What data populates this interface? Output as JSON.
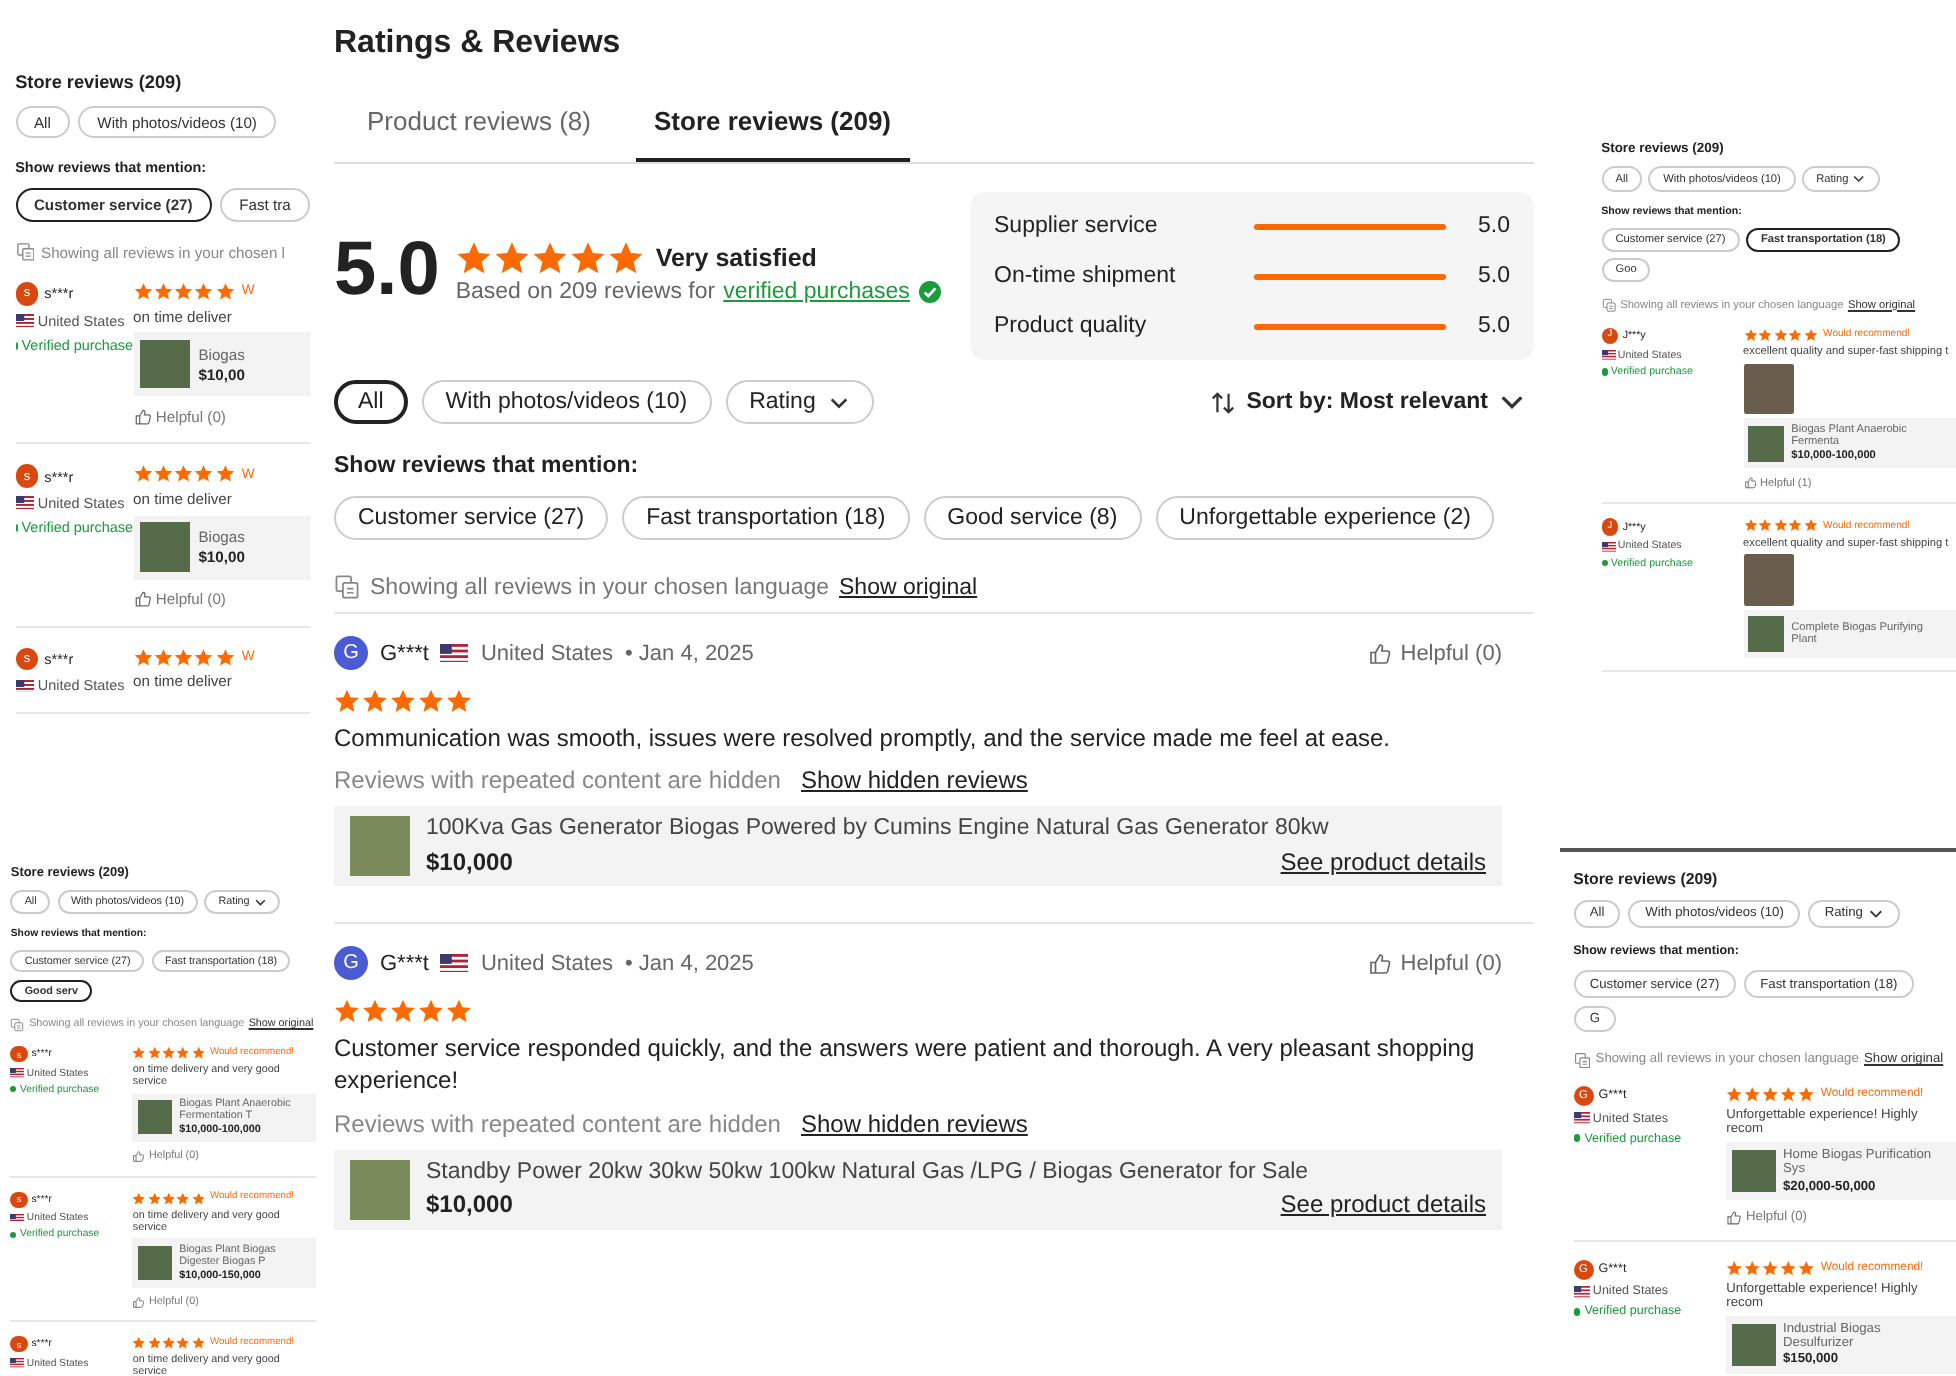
{
  "main": {
    "title": "Ratings & Reviews",
    "tabs": [
      {
        "label": "Product reviews (8)",
        "selected": false
      },
      {
        "label": "Store reviews (209)",
        "selected": true
      }
    ],
    "summary": {
      "score": "5.0",
      "stars": 5,
      "satisfaction": "Very satisfied",
      "based_on": "Based on 209 reviews for",
      "verified_link": "verified purchases",
      "metrics": [
        {
          "label": "Supplier service",
          "level": 1,
          "value": "5.0"
        },
        {
          "label": "On-time shipment",
          "level": 1,
          "value": "5.0"
        },
        {
          "label": "Product quality",
          "level": 1,
          "value": "5.0"
        }
      ]
    },
    "filters": [
      {
        "label": "All",
        "selected": true,
        "kind": "chip"
      },
      {
        "label": "With photos/videos (10)",
        "selected": false,
        "kind": "chip"
      },
      {
        "label": "Rating",
        "selected": false,
        "kind": "dropdown"
      }
    ],
    "sort": "Sort by: Most relevant",
    "mention_heading": "Show reviews that mention:",
    "mentions": [
      {
        "label": "Customer service (27)",
        "selected": false
      },
      {
        "label": "Fast transportation (18)",
        "selected": false
      },
      {
        "label": "Good service (8)",
        "selected": false
      },
      {
        "label": "Unforgettable experience (2)",
        "selected": false
      }
    ],
    "language_note": "Showing all reviews in your chosen language",
    "show_original": "Show original",
    "reviews": [
      {
        "initial": "G",
        "name": "G***t",
        "country": "United States",
        "date": "• Jan 4, 2025",
        "helpful": "Helpful (0)",
        "stars": 5,
        "text": "Communication was smooth, issues were resolved promptly, and the service made me feel at ease.",
        "hidden_note": "Reviews with repeated content are hidden",
        "show_hidden": "Show hidden reviews",
        "product": {
          "title": "100Kva Gas Generator Biogas Powered by Cumins Engine Natural Gas Generator 80kw",
          "price": "$10,000",
          "details": "See product details"
        }
      },
      {
        "initial": "G",
        "name": "G***t",
        "country": "United States",
        "date": "• Jan 4, 2025",
        "helpful": "Helpful (0)",
        "stars": 5,
        "text": "Customer service responded quickly, and the answers were patient and thorough. A very pleasant shopping experience!",
        "hidden_note": "Reviews with repeated content are hidden",
        "show_hidden": "Show hidden reviews",
        "product": {
          "title": "Standby Power 20kw 30kw 50kw 100kw Natural Gas /LPG / Biogas Generator for Sale",
          "price": "$10,000",
          "details": "See product details"
        }
      }
    ]
  },
  "side_panels": [
    {
      "heading": "Store reviews (209)",
      "filters": [
        {
          "label": "All",
          "kind": "chip"
        },
        {
          "label": "With photos/videos (10)",
          "kind": "chip"
        }
      ],
      "mention_heading": "Show reviews that mention:",
      "mentions": [
        {
          "label": "Customer service (27)",
          "selected": true
        },
        {
          "label": "Fast tra",
          "selected": false
        }
      ],
      "language_note": "Showing all reviews in your chosen l",
      "reviews": [
        {
          "initial": "s",
          "name": "s***r",
          "country": "United States",
          "verified": "Verified purchase",
          "stars": 5,
          "recommend": "W",
          "text": "on time deliver",
          "product": {
            "title": "Biogas",
            "price": "$10,00"
          },
          "helpful": "Helpful (0)"
        },
        {
          "initial": "s",
          "name": "s***r",
          "country": "United States",
          "verified": "Verified purchase",
          "stars": 5,
          "recommend": "W",
          "text": "on time deliver",
          "product": {
            "title": "Biogas",
            "price": "$10,00"
          },
          "helpful": "Helpful (0)"
        },
        {
          "initial": "s",
          "name": "s***r",
          "country": "United States",
          "stars": 5,
          "recommend": "W",
          "text": "on time deliver"
        }
      ]
    },
    {
      "heading": "Store reviews (209)",
      "filters": [
        {
          "label": "All",
          "kind": "chip"
        },
        {
          "label": "With photos/videos (10)",
          "kind": "chip"
        },
        {
          "label": "Rating",
          "kind": "dropdown"
        }
      ],
      "mention_heading": "Show reviews that mention:",
      "mentions": [
        {
          "label": "Customer service (27)",
          "selected": false
        },
        {
          "label": "Fast transportation (18)",
          "selected": false
        },
        {
          "label": "Good serv",
          "selected": true
        }
      ],
      "language_note": "Showing all reviews in your chosen language",
      "show_original": "Show original",
      "reviews": [
        {
          "initial": "s",
          "name": "s***r",
          "country": "United States",
          "verified": "Verified purchase",
          "stars": 5,
          "recommend": "Would recommend!",
          "text": "on time delivery and very good service",
          "product": {
            "title": "Biogas Plant Anaerobic Fermentation T",
            "price": "$10,000-100,000"
          },
          "helpful": "Helpful (0)"
        },
        {
          "initial": "s",
          "name": "s***r",
          "country": "United States",
          "verified": "Verified purchase",
          "stars": 5,
          "recommend": "Would recommend!",
          "text": "on time delivery and very good service",
          "product": {
            "title": "Biogas Plant Biogas Digester Biogas P",
            "price": "$10,000-150,000"
          },
          "helpful": "Helpful (0)"
        },
        {
          "initial": "s",
          "name": "s***r",
          "country": "United States",
          "stars": 5,
          "recommend": "Would recommend!",
          "text": "on time delivery and very good service"
        }
      ]
    },
    {
      "heading": "Store reviews (209)",
      "filters": [
        {
          "label": "All",
          "kind": "chip"
        },
        {
          "label": "With photos/videos (10)",
          "kind": "chip"
        },
        {
          "label": "Rating",
          "kind": "dropdown"
        }
      ],
      "mention_heading": "Show reviews that mention:",
      "mentions": [
        {
          "label": "Customer service (27)",
          "selected": false
        },
        {
          "label": "Fast transportation (18)",
          "selected": true
        },
        {
          "label": "Goo",
          "selected": false
        }
      ],
      "language_note": "Showing all reviews in your chosen language",
      "show_original": "Show original",
      "reviews": [
        {
          "initial": "J",
          "name": "J***y",
          "country": "United States",
          "verified": "Verified purchase",
          "stars": 5,
          "recommend": "Would recommend!",
          "text": "excellent quality and super-fast shipping t",
          "photo": true,
          "product": {
            "title": "Biogas Plant Anaerobic Fermenta",
            "price": "$10,000-100,000"
          },
          "helpful": "Helpful (1)"
        },
        {
          "initial": "J",
          "name": "J***y",
          "country": "United States",
          "verified": "Verified purchase",
          "stars": 5,
          "recommend": "Would recommend!",
          "text": "excellent quality and super-fast shipping t",
          "photo": true,
          "product": {
            "title": "Complete Biogas Purifying Plant"
          }
        }
      ]
    },
    {
      "heading": "Store reviews (209)",
      "filters": [
        {
          "label": "All",
          "kind": "chip"
        },
        {
          "label": "With photos/videos (10)",
          "kind": "chip"
        },
        {
          "label": "Rating",
          "kind": "dropdown"
        }
      ],
      "mention_heading": "Show reviews that mention:",
      "mentions": [
        {
          "label": "Customer service (27)",
          "selected": false
        },
        {
          "label": "Fast transportation (18)",
          "selected": false
        },
        {
          "label": "G",
          "selected": false
        }
      ],
      "language_note": "Showing all reviews in your chosen language",
      "show_original": "Show original",
      "reviews": [
        {
          "initial": "G",
          "name": "G***t",
          "country": "United States",
          "verified": "Verified purchase",
          "stars": 5,
          "recommend": "Would recommend!",
          "text": "Unforgettable experience! Highly recom",
          "product": {
            "title": "Home Biogas Purification Sys",
            "price": "$20,000-50,000"
          },
          "helpful": "Helpful (0)"
        },
        {
          "initial": "G",
          "name": "G***t",
          "country": "United States",
          "verified": "Verified purchase",
          "stars": 5,
          "recommend": "Would recommend!",
          "text": "Unforgettable experience! Highly recom",
          "product": {
            "title": "Industrial Biogas Desulfurizer",
            "price": "$150,000"
          }
        }
      ]
    }
  ]
}
